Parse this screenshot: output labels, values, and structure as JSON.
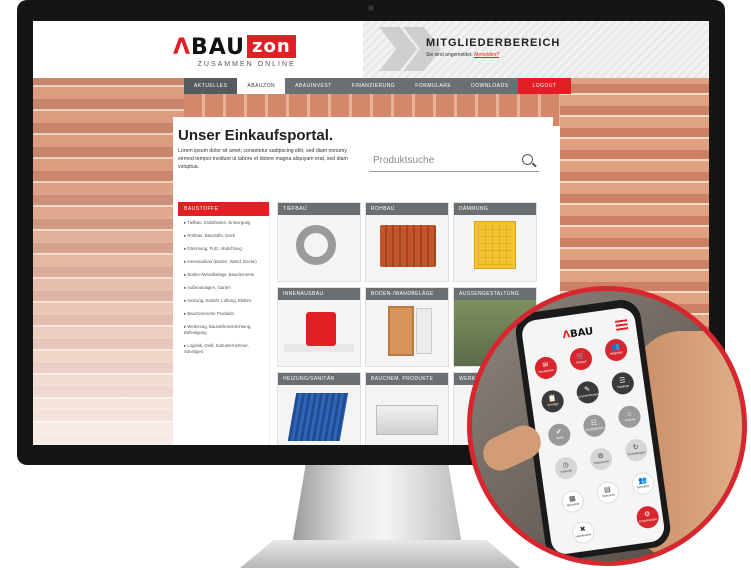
{
  "header": {
    "logo_main": "BAU",
    "logo_zon": "zon",
    "logo_tagline": "ZUSAMMEN ONLINE",
    "member_title": "MITGLIEDERBEREICH",
    "member_status": "Sie sind angemeldet.",
    "logout_link": "Abmelden?"
  },
  "nav": {
    "items": [
      "AKTUELLES",
      "ABAUZON",
      "ABAUINVEST",
      "FINANZIERUNG",
      "FORMULARE",
      "DOWNLOADS"
    ],
    "logout": "LOGOUT"
  },
  "main": {
    "title": "Unser Einkaufsportal.",
    "description": "Lorem ipsum dolor sit amet, consetetur sadipscing elitr, sed diam nonumy eirmod tempor invidunt ut labore et dolore magna aliquyam erat, sed diam voluptua.",
    "search_placeholder": "Produktsuche"
  },
  "sidebar": {
    "header": "BAUSTOFFE",
    "items": [
      "Tiefbau, Erdarbeiten, Entsorgung",
      "Rohbau, Baustoffe, Dach",
      "Dämmung, Putz, Abdichtung",
      "Innenausbau (Boden, Wand, Decke)",
      "Boden-/Wandbeläge, Bauelemente",
      "Außenanlagen, Garten",
      "Heizung, Sanitär, Lüftung, Elektro",
      "Bauchemische Produkte",
      "Werkzeug, Baustelleneinrichtung, Befestigung",
      "Logistik, Geld, Subunternehmer, Sonstiges"
    ]
  },
  "tiles": [
    {
      "label": "TIEFBAU",
      "icon": "pipe-icon"
    },
    {
      "label": "ROHBAU",
      "icon": "brick-icon"
    },
    {
      "label": "DÄMMUNG",
      "icon": "insulation-icon"
    },
    {
      "label": "INNENAUSBAU",
      "icon": "bucket-icon"
    },
    {
      "label": "BODEN-/WANDBELÄGE",
      "icon": "door-icon"
    },
    {
      "label": "AUSSENGESTALTUNG",
      "icon": "terrace-icon"
    },
    {
      "label": "HEIZUNG/SANITÄR",
      "icon": "solar-panel-icon"
    },
    {
      "label": "BAUCHEM. PRODUKTE",
      "icon": "boards-icon"
    },
    {
      "label": "WERKZ",
      "icon": "tools-icon"
    }
  ],
  "phone": {
    "logo": "BAU",
    "buttons": [
      {
        "label": "Neuigkeiten",
        "glyph": "✉",
        "style": "red"
      },
      {
        "label": "Einkauf",
        "glyph": "🛒",
        "style": "red"
      },
      {
        "label": "Mitglieder",
        "glyph": "👥",
        "style": "red"
      },
      {
        "label": "Verträge",
        "glyph": "📋",
        "style": "dark"
      },
      {
        "label": "Ausschreibungen",
        "glyph": "✎",
        "style": "dark"
      },
      {
        "label": "Kataloge",
        "glyph": "☰",
        "style": "dark"
      },
      {
        "label": "Tools",
        "glyph": "✔",
        "style": "grey"
      },
      {
        "label": "Fortbildungen",
        "glyph": "☷",
        "style": "grey"
      },
      {
        "label": "Termine",
        "glyph": "⌂",
        "style": "grey"
      },
      {
        "label": "Kalender",
        "glyph": "◷",
        "style": "light"
      },
      {
        "label": "Dokumente",
        "glyph": "⚙",
        "style": "light"
      },
      {
        "label": "Einstellungen",
        "glyph": "↻",
        "style": "light"
      },
      {
        "label": "Baustelle",
        "glyph": "▦",
        "style": "white"
      },
      {
        "label": "Übersicht",
        "glyph": "▤",
        "style": "white"
      },
      {
        "label": "Benutzer",
        "glyph": "👥",
        "style": "white"
      },
      {
        "label": "Handwerker",
        "glyph": "✖",
        "style": "white"
      },
      {
        "label": "Einstellungen",
        "glyph": "⚙",
        "style": "red"
      }
    ]
  }
}
